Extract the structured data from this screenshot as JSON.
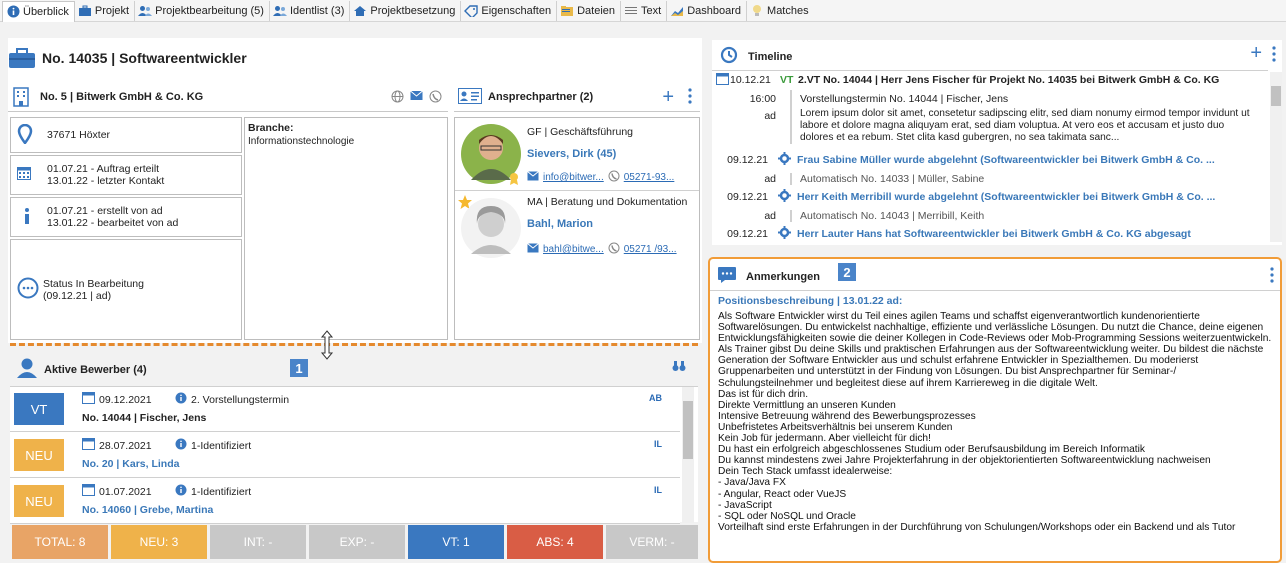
{
  "tabs": [
    {
      "label": "Überblick",
      "icon": "info-icon",
      "active": true
    },
    {
      "label": "Projekt",
      "icon": "briefcase-icon"
    },
    {
      "label": "Projektbearbeitung (5)",
      "icon": "people-icon"
    },
    {
      "label": "Identlist (3)",
      "icon": "people-icon"
    },
    {
      "label": "Projektbesetzung",
      "icon": "house-icon"
    },
    {
      "label": "Eigenschaften",
      "icon": "tag-icon"
    },
    {
      "label": "Dateien",
      "icon": "folder-icon"
    },
    {
      "label": "Text",
      "icon": "text-lines-icon"
    },
    {
      "label": "Dashboard",
      "icon": "chart-icon"
    },
    {
      "label": "Matches",
      "icon": "lightbulb-icon"
    }
  ],
  "project": {
    "title": "No. 14035 | Softwareentwickler",
    "company": "No. 5 | Bitwerk GmbH & Co. KG",
    "location": "37671 Höxter",
    "order_line1": "01.07.21 - Auftrag erteilt",
    "order_line2": "13.01.22 - letzter Kontakt",
    "created_line1": "01.07.21 - erstellt von ad",
    "created_line2": "13.01.22 - bearbeitet von ad",
    "status_line1": "Status In Bearbeitung",
    "status_line2": "(09.12.21 | ad)",
    "branche_label": "Branche:",
    "branche_value": "Informationstechnologie"
  },
  "contacts": {
    "title": "Ansprechpartner (2)",
    "items": [
      {
        "role": "GF | Geschäftsführung",
        "name": "Sievers, Dirk (45)",
        "email": "info@bitwer...",
        "phone": "05271-93..."
      },
      {
        "role": "MA | Beratung und Dokumentation",
        "name": "Bahl, Marion",
        "email": "bahl@bitwe...",
        "phone": "05271 /93..."
      }
    ]
  },
  "timeline": {
    "title": "Timeline",
    "rows": [
      {
        "date": "10.12.21",
        "type": "VT",
        "text": "2.VT No. 14044 | Herr Jens Fischer für Projekt No. 14035 bei Bitwerk GmbH & Co. KG"
      },
      {
        "date": "16:00",
        "text": "Vorstellungstermin   No. 14044 | Fischer, Jens"
      },
      {
        "date": "ad",
        "text": "Lorem ipsum dolor sit amet, consetetur sadipscing elitr, sed diam nonumy eirmod tempor invidunt ut labore et dolore magna aliquyam erat, sed diam voluptua. At vero eos et accusam et justo duo dolores et ea rebum. Stet clita kasd gubergren, no sea takimata sanc..."
      },
      {
        "date": "09.12.21",
        "text": "Frau Sabine Müller wurde abgelehnt (Softwareentwickler bei Bitwerk GmbH & Co. ..."
      },
      {
        "date": "ad",
        "text": "Automatisch      No. 14033 | Müller, Sabine"
      },
      {
        "date": "09.12.21",
        "text": "Herr Keith Merribill wurde abgelehnt (Softwareentwickler bei Bitwerk GmbH & Co. ..."
      },
      {
        "date": "ad",
        "text": "Automatisch      No. 14043 | Merribill, Keith"
      },
      {
        "date": "09.12.21",
        "text": "Herr Lauter Hans hat Softwareentwickler bei Bitwerk GmbH & Co. KG abgesagt"
      }
    ]
  },
  "notes": {
    "title": "Anmerkungen",
    "badge": "2",
    "heading": "Positionsbeschreibung | 13.01.22 ad:",
    "lines": [
      "Als Software Entwickler wirst du Teil eines agilen Teams und schaffst eigenverantwortlich kundenorientierte Softwarelösungen. Du entwickelst nachhaltige, effiziente und verlässliche Lösungen. Du nutzt die Chance, deine eigenen Entwicklungsfähigkeiten sowie die deiner Kollegen in Code-Reviews oder Mob-Programming Sessions weiterzuentwickeln.",
      "Als Trainer gibst Du deine Skills und praktischen Erfahrungen aus der Softwareentwicklung weiter. Du bildest die nächste Generation der Software Entwickler aus und schulst erfahrene Entwickler in Spezialthemen. Du moderierst Gruppenarbeiten und unterstützt in der Findung von Lösungen. Du bist Ansprechpartner für Seminar-/ Schulungsteilnehmer und begleitest diese auf ihrem Karriereweg in die digitale Welt.",
      "Das ist für dich drin.",
      "Direkte Vermittlung an unseren Kunden",
      "Intensive Betreuung während des Bewerbungsprozesses",
      "Unbefristetes Arbeitsverhältnis bei unserem Kunden",
      "Kein Job für jedermann. Aber vielleicht für dich!",
      "Du hast ein erfolgreich abgeschlossenes Studium oder Berufsausbildung im Bereich Informatik",
      "Du kannst mindestens zwei Jahre Projekterfahrung in der objektorientierten Softwareentwicklung  nachweisen",
      "Dein Tech Stack umfasst idealerweise:",
      "- Java/Java FX",
      "- Angular, React oder VueJS",
      "- JavaScript",
      "- SQL oder NoSQL und Oracle",
      "Vorteilhaft sind erste Erfahrungen in der Durchführung von Schulungen/Workshops oder ein Backend und als Tutor"
    ]
  },
  "applicants": {
    "title": "Aktive Bewerber (4)",
    "badge": "1",
    "rows": [
      {
        "tag": "VT",
        "tag_color": "#3a78c0",
        "date": "09.12.2021",
        "stage": "2. Vorstellungstermin",
        "name": "No. 14044 | Fischer, Jens",
        "code": "AB",
        "name_blue": false
      },
      {
        "tag": "NEU",
        "tag_color": "#efb24a",
        "date": "28.07.2021",
        "stage": "1-Identifiziert",
        "name": "No. 20 | Kars, Linda",
        "code": "IL",
        "name_blue": true
      },
      {
        "tag": "NEU",
        "tag_color": "#efb24a",
        "date": "01.07.2021",
        "stage": "1-Identifiziert",
        "name": "No. 14060 | Grebe, Martina",
        "code": "IL",
        "name_blue": true
      }
    ]
  },
  "stats": [
    {
      "label": "TOTAL: 8",
      "color": "#e8a466"
    },
    {
      "label": "NEU: 3",
      "color": "#efb24a"
    },
    {
      "label": "INT: -",
      "color": "#c8c8c8"
    },
    {
      "label": "EXP: -",
      "color": "#c8c8c8"
    },
    {
      "label": "VT: 1",
      "color": "#3a78c0"
    },
    {
      "label": "ABS: 4",
      "color": "#d95d45"
    },
    {
      "label": "VERM: -",
      "color": "#c8c8c8"
    }
  ]
}
